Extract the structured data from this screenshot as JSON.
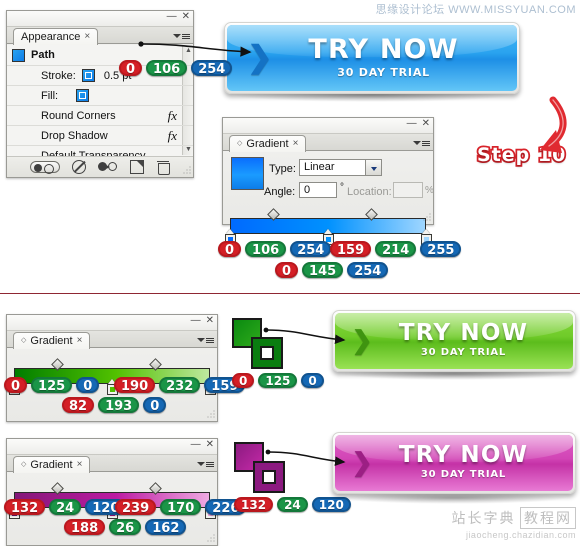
{
  "watermarks": {
    "top": "思缘设计论坛  WWW.MISSYUAN.COM",
    "bottom_cn_left": "站长字典",
    "bottom_cn_right": "教程网",
    "bottom_url": "jiaocheng.chazidian.com"
  },
  "appearance_panel": {
    "tab_label": "Appearance",
    "tab_close": "×",
    "minimize": "—",
    "close": "✕",
    "rows": [
      {
        "name": "path",
        "label": "Path",
        "swatch": "#1e8fe6",
        "fx": ""
      },
      {
        "name": "stroke",
        "label": "Stroke:",
        "swatch": "#1e8fe6",
        "value": "0.5 pt",
        "fx": ""
      },
      {
        "name": "fill",
        "label": "Fill:",
        "swatch": "#1e8fe6",
        "value": "",
        "fx": ""
      },
      {
        "name": "round-corners",
        "label": "Round Corners",
        "value": "",
        "fx": "fx"
      },
      {
        "name": "drop-shadow",
        "label": "Drop Shadow",
        "value": "",
        "fx": "fx"
      },
      {
        "name": "default-transparency",
        "label": "Default Transparency",
        "value": "",
        "fx": ""
      }
    ],
    "toolbar_icons": [
      "visibility-toggle",
      "clear-appearance-icon",
      "duplicate-item-icon",
      "new-art-icon",
      "delete-icon"
    ],
    "stroke_rgb": {
      "r": "0",
      "g": "106",
      "b": "254"
    }
  },
  "gradient_blue": {
    "tab_label": "Gradient",
    "tab_close": "×",
    "minimize": "—",
    "close": "✕",
    "type_label": "Type:",
    "type_value": "Linear",
    "angle_label": "Angle:",
    "angle_value": "0",
    "degree": "°",
    "location_label": "Location:",
    "location_value": "",
    "percent": "%",
    "swatch_css": "linear-gradient(180deg,#0a6ffd 0%,#1a9bff 55%,#0d7ce8 100%)",
    "bar_css": "linear-gradient(90deg,#006afe 0%,#0091fe 50%,#9fd6ff 100%)",
    "stops": [
      {
        "pos": 0,
        "color": "#006afe"
      },
      {
        "pos": 50,
        "color": "#0091fe"
      },
      {
        "pos": 100,
        "color": "#9fd6ff"
      }
    ],
    "midpoints": [
      22,
      72
    ],
    "stop_values": [
      {
        "r": "0",
        "g": "106",
        "b": "254"
      },
      {
        "r": "159",
        "g": "214",
        "b": "255"
      },
      {
        "r": "0",
        "g": "145",
        "b": "254"
      }
    ]
  },
  "gradient_green": {
    "tab_label": "Gradient",
    "tab_close": "×",
    "minimize": "—",
    "close": "✕",
    "bar_css": "linear-gradient(90deg,#007d00 0%,#52c100 52%,#beE89f 100%)",
    "stops": [
      {
        "pos": 0,
        "color": "#007d00"
      },
      {
        "pos": 50,
        "color": "#52c100"
      },
      {
        "pos": 100,
        "color": "#bee89f"
      }
    ],
    "midpoints": [
      22,
      72
    ],
    "stop_values": [
      {
        "r": "0",
        "g": "125",
        "b": "0"
      },
      {
        "r": "190",
        "g": "232",
        "b": "159"
      },
      {
        "r": "82",
        "g": "193",
        "b": "0"
      }
    ],
    "swatch_pair_rgb": {
      "r": "0",
      "g": "125",
      "b": "0"
    },
    "swatch_pair_color_1": "linear-gradient(135deg,#0a8a10,#2faa1c)",
    "swatch_pair_color_2": "#0a7d10"
  },
  "gradient_magenta": {
    "tab_label": "Gradient",
    "tab_close": "×",
    "minimize": "—",
    "close": "✕",
    "bar_css": "linear-gradient(90deg,#841878 0%,#bc1aa2 52%,#efaae2 100%)",
    "stops": [
      {
        "pos": 0,
        "color": "#841878"
      },
      {
        "pos": 50,
        "color": "#bc1aa2"
      },
      {
        "pos": 100,
        "color": "#efaae2"
      }
    ],
    "midpoints": [
      22,
      72
    ],
    "stop_values": [
      {
        "r": "132",
        "g": "24",
        "b": "120"
      },
      {
        "r": "239",
        "g": "170",
        "b": "226"
      },
      {
        "r": "188",
        "g": "26",
        "b": "162"
      }
    ],
    "swatch_pair_rgb": {
      "r": "132",
      "g": "24",
      "b": "120"
    },
    "swatch_pair_color_1": "linear-gradient(135deg,#8c1a80,#c42aa8)",
    "swatch_pair_color_2": "#8c1a80"
  },
  "buttons": [
    {
      "name": "try-now-blue",
      "title": "TRY NOW",
      "subtitle": "30 DAY TRIAL",
      "chevron": "❯",
      "face_css": "linear-gradient(180deg,#43b8f5 0%,#2aa3ef 42%,#1d8fe6 52%,#63c6f7 100%)",
      "chevron_color": "#1472c4"
    },
    {
      "name": "try-now-green",
      "title": "TRY NOW",
      "subtitle": "30 DAY TRIAL",
      "chevron": "❯",
      "face_css": "linear-gradient(180deg,#86d83c 0%,#6fcb29 42%,#5cbc1c 52%,#9ae255 100%)",
      "chevron_color": "#3f9410"
    },
    {
      "name": "try-now-magenta",
      "title": "TRY NOW",
      "subtitle": "30 DAY TRIAL",
      "chevron": "❯",
      "face_css": "linear-gradient(180deg,#dd5cc4 0%,#d245b6 42%,#c432a6 52%,#e87ad4 100%)",
      "chevron_color": "#9c1f84"
    }
  ],
  "step_badge": {
    "label": "Step 10",
    "color": "#d8232a"
  }
}
